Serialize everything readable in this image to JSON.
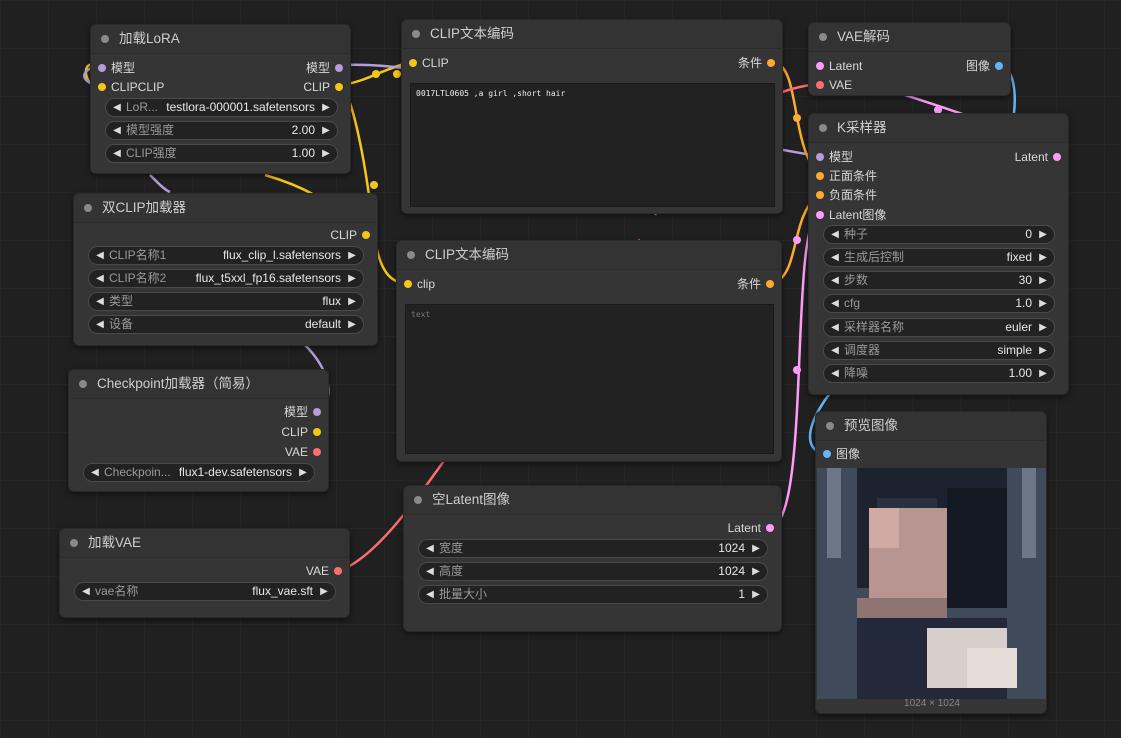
{
  "colors": {
    "model": "#b39ddb",
    "clip": "#f5c518",
    "vae": "#ff6e6e",
    "conditioning": "#ffa931",
    "latent": "#ff9cf9",
    "image": "#64b5f6"
  },
  "nodes": {
    "load_lora": {
      "title": "加载LoRA",
      "in_model": "模型",
      "in_clip": "CLIPCLIP",
      "out_model": "模型",
      "out_clip": "CLIP",
      "w_lora_label": "LoR...",
      "w_lora_value": "testlora-000001.safetensors",
      "w_model_strength_label": "模型强度",
      "w_model_strength_value": "2.00",
      "w_clip_strength_label": "CLIP强度",
      "w_clip_strength_value": "1.00"
    },
    "dual_clip": {
      "title": "双CLIP加载器",
      "out_clip": "CLIP",
      "w_clip1_label": "CLIP名称1",
      "w_clip1_value": "flux_clip_l.safetensors",
      "w_clip2_label": "CLIP名称2",
      "w_clip2_value": "flux_t5xxl_fp16.safetensors",
      "w_type_label": "类型",
      "w_type_value": "flux",
      "w_device_label": "设备",
      "w_device_value": "default"
    },
    "checkpoint": {
      "title": "Checkpoint加载器（简易）",
      "out_model": "模型",
      "out_clip": "CLIP",
      "out_vae": "VAE",
      "w_ckpt_label": "Checkpoin...",
      "w_ckpt_value": "flux1-dev.safetensors"
    },
    "load_vae": {
      "title": "加载VAE",
      "out_vae": "VAE",
      "w_vae_label": "vae名称",
      "w_vae_value": "flux_vae.sft"
    },
    "clip_text_pos": {
      "title": "CLIP文本编码",
      "in_clip": "CLIP",
      "out_cond": "条件",
      "text": "0017LTL0605 ,a girl ,short hair"
    },
    "clip_text_neg": {
      "title": "CLIP文本编码",
      "in_clip": "clip",
      "out_cond": "条件",
      "placeholder": "text"
    },
    "empty_latent": {
      "title": "空Latent图像",
      "out_latent": "Latent",
      "w_width_label": "宽度",
      "w_width_value": "1024",
      "w_height_label": "高度",
      "w_height_value": "1024",
      "w_batch_label": "批量大小",
      "w_batch_value": "1"
    },
    "vae_decode": {
      "title": "VAE解码",
      "in_latent": "Latent",
      "in_vae": "VAE",
      "out_image": "图像"
    },
    "ksampler": {
      "title": "K采样器",
      "in_model": "模型",
      "in_pos": "正面条件",
      "in_neg": "负面条件",
      "in_latent": "Latent图像",
      "out_latent": "Latent",
      "w_seed_label": "种子",
      "w_seed_value": "0",
      "w_control_label": "生成后控制",
      "w_control_value": "fixed",
      "w_steps_label": "步数",
      "w_steps_value": "30",
      "w_cfg_label": "cfg",
      "w_cfg_value": "1.0",
      "w_sampler_label": "采样器名称",
      "w_sampler_value": "euler",
      "w_scheduler_label": "调度器",
      "w_scheduler_value": "simple",
      "w_denoise_label": "降噪",
      "w_denoise_value": "1.00"
    },
    "preview": {
      "title": "预览图像",
      "in_image": "图像",
      "caption": "1024 × 1024"
    }
  }
}
